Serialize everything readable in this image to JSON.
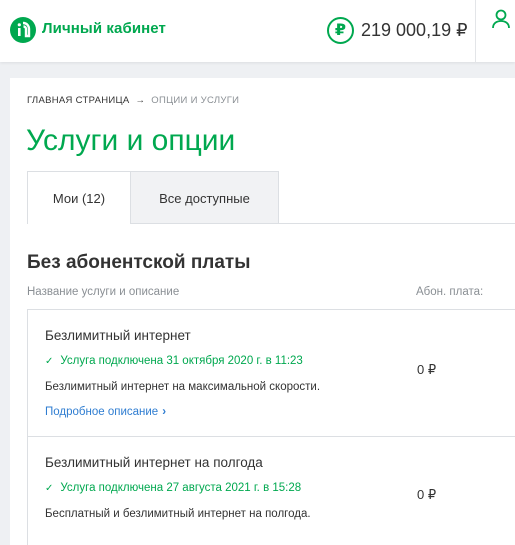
{
  "header": {
    "brand": "Личный кабинет",
    "balance_symbol": "₽",
    "balance": "219 000,19 ₽",
    "logo_icon": "megafon-logo-icon",
    "user_icon": "user-icon",
    "accent": "#00a84f"
  },
  "breadcrumb": {
    "home": "ГЛАВНАЯ СТРАНИЦА",
    "separator": "→",
    "current": "ОПЦИИ И УСЛУГИ"
  },
  "page": {
    "title": "Услуги и опции"
  },
  "tabs": [
    {
      "label": "Мои (12)",
      "active": true
    },
    {
      "label": "Все доступные",
      "active": false
    }
  ],
  "section": {
    "title": "Без абонентской платы",
    "col_name": "Название услуги и описание",
    "col_fee": "Абон. плата:"
  },
  "services": [
    {
      "name": "Безлимитный интернет",
      "status": "Услуга подключена 31 октября 2020 г. в 11:23",
      "description": "Безлимитный интернет на максимальной скорости.",
      "more": "Подробное описание",
      "fee": "0 ₽"
    },
    {
      "name": "Безлимитный интернет на полгода",
      "status": "Услуга подключена 27 августа 2021 г. в 15:28",
      "description": "Бесплатный и безлимитный интернет на полгода.",
      "fee": "0 ₽"
    }
  ]
}
